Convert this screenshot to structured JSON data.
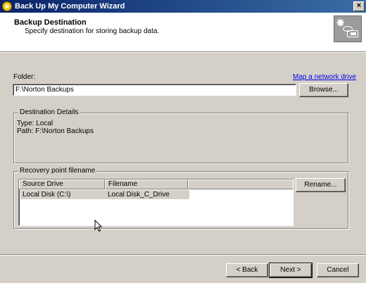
{
  "window": {
    "title": "Back Up My Computer Wizard",
    "close_glyph": "×"
  },
  "header": {
    "title": "Backup Destination",
    "subtitle": "Specify destination for storing backup data.",
    "icon": "backup-destination-icon"
  },
  "folder": {
    "label": "Folder:",
    "value": "F:\\Norton Backups",
    "map_link": "Map a network drive",
    "browse_label": "Browse..."
  },
  "destination": {
    "legend": "Destination Details",
    "type_line": "Type: Local",
    "path_line": "Path: F:\\Norton Backups"
  },
  "recovery": {
    "legend": "Recovery point filename",
    "columns": [
      "Source Drive",
      "Filename"
    ],
    "rows": [
      {
        "source": "Local Disk (C:\\)",
        "filename": "Local Disk_C_Drive"
      }
    ],
    "rename_label": "Rename..."
  },
  "footer": {
    "back_label": "< Back",
    "next_label": "Next >",
    "cancel_label": "Cancel"
  }
}
